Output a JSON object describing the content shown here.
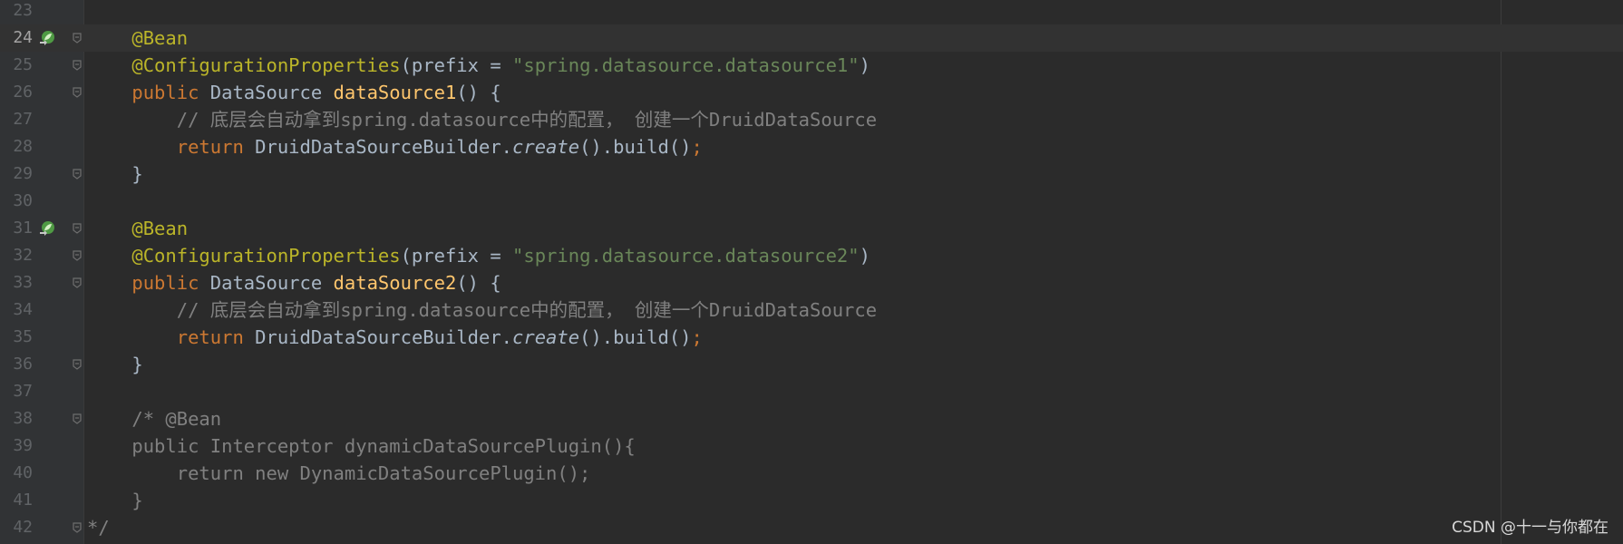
{
  "editor": {
    "lines": [
      {
        "number": "23",
        "tokens": []
      },
      {
        "number": "24",
        "tokens": [
          {
            "t": "    ",
            "c": "plain"
          },
          {
            "t": "@Bean",
            "c": "annotation"
          }
        ]
      },
      {
        "number": "25",
        "tokens": [
          {
            "t": "    ",
            "c": "plain"
          },
          {
            "t": "@ConfigurationProperties",
            "c": "annotation"
          },
          {
            "t": "(prefix = ",
            "c": "plain"
          },
          {
            "t": "\"spring.datasource.datasource1\"",
            "c": "string"
          },
          {
            "t": ")",
            "c": "plain"
          }
        ]
      },
      {
        "number": "26",
        "tokens": [
          {
            "t": "    ",
            "c": "plain"
          },
          {
            "t": "public ",
            "c": "keyword"
          },
          {
            "t": "DataSource ",
            "c": "plain"
          },
          {
            "t": "dataSource1",
            "c": "method"
          },
          {
            "t": "() {",
            "c": "plain"
          }
        ]
      },
      {
        "number": "27",
        "tokens": [
          {
            "t": "        ",
            "c": "plain"
          },
          {
            "t": "// 底层会自动拿到spring.datasource中的配置， 创建一个DruidDataSource",
            "c": "comment"
          }
        ]
      },
      {
        "number": "28",
        "tokens": [
          {
            "t": "        ",
            "c": "plain"
          },
          {
            "t": "return ",
            "c": "keyword"
          },
          {
            "t": "DruidDataSourceBuilder.",
            "c": "plain"
          },
          {
            "t": "create",
            "c": "static"
          },
          {
            "t": "().build()",
            "c": "plain"
          },
          {
            "t": ";",
            "c": "semicolon"
          }
        ]
      },
      {
        "number": "29",
        "tokens": [
          {
            "t": "    }",
            "c": "plain"
          }
        ]
      },
      {
        "number": "30",
        "tokens": []
      },
      {
        "number": "31",
        "tokens": [
          {
            "t": "    ",
            "c": "plain"
          },
          {
            "t": "@Bean",
            "c": "annotation"
          }
        ]
      },
      {
        "number": "32",
        "tokens": [
          {
            "t": "    ",
            "c": "plain"
          },
          {
            "t": "@ConfigurationProperties",
            "c": "annotation"
          },
          {
            "t": "(prefix = ",
            "c": "plain"
          },
          {
            "t": "\"spring.datasource.datasource2\"",
            "c": "string"
          },
          {
            "t": ")",
            "c": "plain"
          }
        ]
      },
      {
        "number": "33",
        "tokens": [
          {
            "t": "    ",
            "c": "plain"
          },
          {
            "t": "public ",
            "c": "keyword"
          },
          {
            "t": "DataSource ",
            "c": "plain"
          },
          {
            "t": "dataSource2",
            "c": "method"
          },
          {
            "t": "() {",
            "c": "plain"
          }
        ]
      },
      {
        "number": "34",
        "tokens": [
          {
            "t": "        ",
            "c": "plain"
          },
          {
            "t": "// 底层会自动拿到spring.datasource中的配置， 创建一个DruidDataSource",
            "c": "comment"
          }
        ]
      },
      {
        "number": "35",
        "tokens": [
          {
            "t": "        ",
            "c": "plain"
          },
          {
            "t": "return ",
            "c": "keyword"
          },
          {
            "t": "DruidDataSourceBuilder.",
            "c": "plain"
          },
          {
            "t": "create",
            "c": "static"
          },
          {
            "t": "().build()",
            "c": "plain"
          },
          {
            "t": ";",
            "c": "semicolon"
          }
        ]
      },
      {
        "number": "36",
        "tokens": [
          {
            "t": "    }",
            "c": "plain"
          }
        ]
      },
      {
        "number": "37",
        "tokens": []
      },
      {
        "number": "38",
        "tokens": [
          {
            "t": "    /* @Bean",
            "c": "comment"
          }
        ]
      },
      {
        "number": "39",
        "tokens": [
          {
            "t": "    public Interceptor dynamicDataSourcePlugin(){",
            "c": "comment"
          }
        ]
      },
      {
        "number": "40",
        "tokens": [
          {
            "t": "        return new DynamicDataSourcePlugin();",
            "c": "comment"
          }
        ]
      },
      {
        "number": "41",
        "tokens": [
          {
            "t": "    }",
            "c": "comment"
          }
        ]
      },
      {
        "number": "42",
        "tokens": [
          {
            "t": "*/",
            "c": "comment"
          }
        ]
      }
    ],
    "current_line": "24",
    "run_gutter_lines": [
      "24",
      "31"
    ],
    "fold_lines": [
      "24",
      "25",
      "26",
      "29",
      "31",
      "32",
      "33",
      "36",
      "38",
      "42"
    ]
  },
  "watermark": "CSDN @十一与你都在",
  "icons": {
    "run": "spring-bean-run-icon",
    "fold": "fold-marker-icon"
  },
  "colors": {
    "background": "#2b2b2b",
    "gutter": "#313335",
    "annotation": "#bbb529",
    "keyword": "#cc7832",
    "string": "#6a8759",
    "method": "#ffc66d",
    "comment": "#808080",
    "text": "#a9b7c6",
    "line_number": "#606366"
  }
}
